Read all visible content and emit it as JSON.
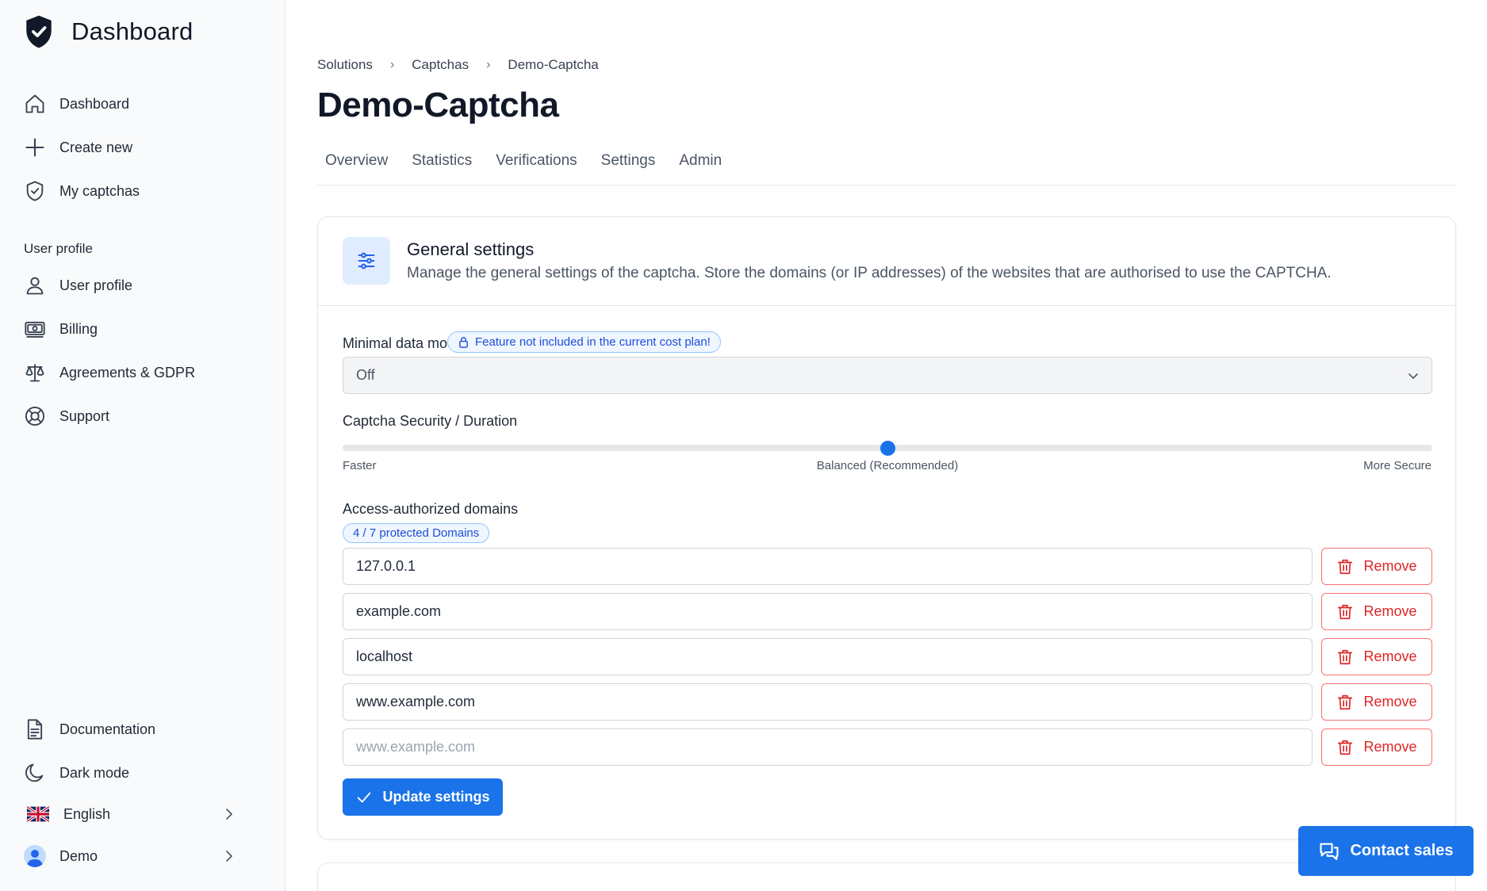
{
  "sidebar": {
    "brand_title": "Dashboard",
    "brand_icon": "shield-check-icon",
    "nav": [
      {
        "label": "Dashboard",
        "icon": "home-icon"
      },
      {
        "label": "Create new",
        "icon": "plus-icon"
      },
      {
        "label": "My captchas",
        "icon": "shield-check-icon"
      }
    ],
    "section_label": "User profile",
    "profile_nav": [
      {
        "label": "User profile",
        "icon": "user-icon"
      },
      {
        "label": "Billing",
        "icon": "banknote-icon"
      },
      {
        "label": "Agreements & GDPR",
        "icon": "scale-icon"
      },
      {
        "label": "Support",
        "icon": "lifebuoy-icon"
      }
    ],
    "bottom": {
      "documentation": "Documentation",
      "dark_mode": "Dark mode",
      "language": "English",
      "user": "Demo"
    }
  },
  "breadcrumb": [
    "Solutions",
    "Captchas",
    "Demo-Captcha"
  ],
  "page_title": "Demo-Captcha",
  "tabs": [
    "Overview",
    "Statistics",
    "Verifications",
    "Settings",
    "Admin"
  ],
  "general": {
    "title": "General settings",
    "description": "Manage the general settings of the captcha. Store the domains (or IP addresses) of the websites that are authorised to use the CAPTCHA.",
    "minimal_data_label": "Minimal data mode",
    "feature_badge": "Feature not included in the current cost plan!",
    "minimal_data_value": "Off",
    "security_label": "Captcha Security / Duration",
    "slider": {
      "left": "Faster",
      "middle": "Balanced (Recommended)",
      "right": "More Secure",
      "value_fraction": 0.5
    },
    "domains_label": "Access-authorized domains",
    "domains_badge": "4 / 7 protected Domains",
    "domains": [
      "127.0.0.1",
      "example.com",
      "localhost",
      "www.example.com"
    ],
    "new_domain_placeholder": "www.example.com",
    "remove_label": "Remove",
    "update_label": "Update settings"
  },
  "contact_sales": "Contact sales",
  "colors": {
    "primary": "#1a73e8",
    "danger": "#dc2626",
    "badge_bg": "#eff6ff"
  }
}
